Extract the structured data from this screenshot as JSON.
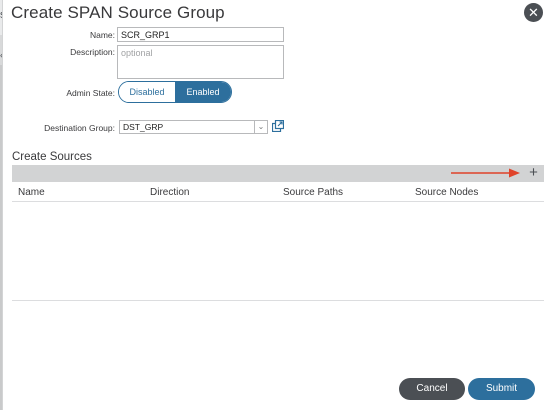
{
  "background": {
    "left_glyph": "s",
    "left_glyph2": "‹"
  },
  "dialog": {
    "title": "Create SPAN Source Group",
    "close_icon": "✕"
  },
  "form": {
    "name_label": "Name:",
    "name_value": "SCR_GRP1",
    "description_label": "Description:",
    "description_placeholder": "optional",
    "admin_state_label": "Admin State:",
    "admin_state_options": [
      "Disabled",
      "Enabled"
    ],
    "admin_state_selected": "Enabled",
    "destination_group_label": "Destination Group:",
    "destination_group_value": "DST_GRP"
  },
  "sources": {
    "title": "Create Sources",
    "add_icon": "+",
    "columns": [
      "Name",
      "Direction",
      "Source Paths",
      "Source Nodes"
    ],
    "rows": []
  },
  "footer": {
    "cancel_label": "Cancel",
    "submit_label": "Submit"
  },
  "colors": {
    "accent": "#2d6f9d",
    "dark_button": "#4b4f54",
    "annotation_arrow": "#e0432a"
  }
}
